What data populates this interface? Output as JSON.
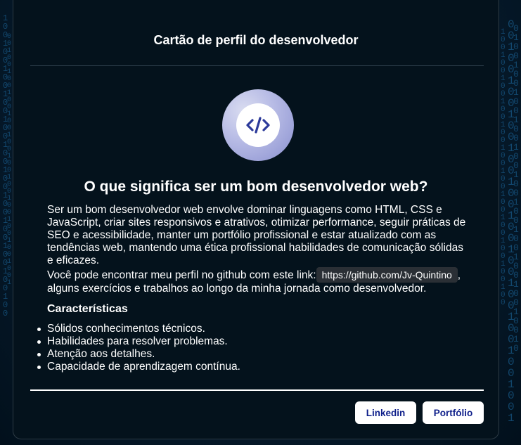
{
  "card": {
    "title": "Cartão de perfil do desenvolvedor",
    "logo_icon": "code-icon",
    "headline": "O que significa ser um bom desenvolvedor web?",
    "description": "Ser um bom desenvolvedor web envolve dominar linguagens como HTML, CSS e JavaScript, criar sites responsivos e atrativos, otimizar performance, seguir práticas de SEO e acessibilidade, manter um portfólio profissional e estar atualizado com as tendências web, mantendo uma ética profissional habilidades de comunicação sólidas e eficazes.",
    "github_prefix": "Você pode encontrar meu perfil no github com este link:",
    "github_link": "https://github.com/Jv-Quintino",
    "github_suffix": ", alguns exercícios e trabalhos ao longo da minha jornada como desenvolvedor.",
    "features_heading": "Características",
    "features": [
      "Sólidos conhecimentos técnicos.",
      "Habilidades para resolver problemas.",
      "Atenção aos detalhes.",
      "Capacidade de aprendizagem contínua."
    ],
    "buttons": {
      "linkedin": "Linkedin",
      "portfolio": "Portfólio"
    }
  },
  "colors": {
    "background": "#071d30",
    "card": "#04121c",
    "button_text": "#0d1e8a",
    "logo": "#b9bde6",
    "logo_glyph": "#2c3a9a"
  }
}
